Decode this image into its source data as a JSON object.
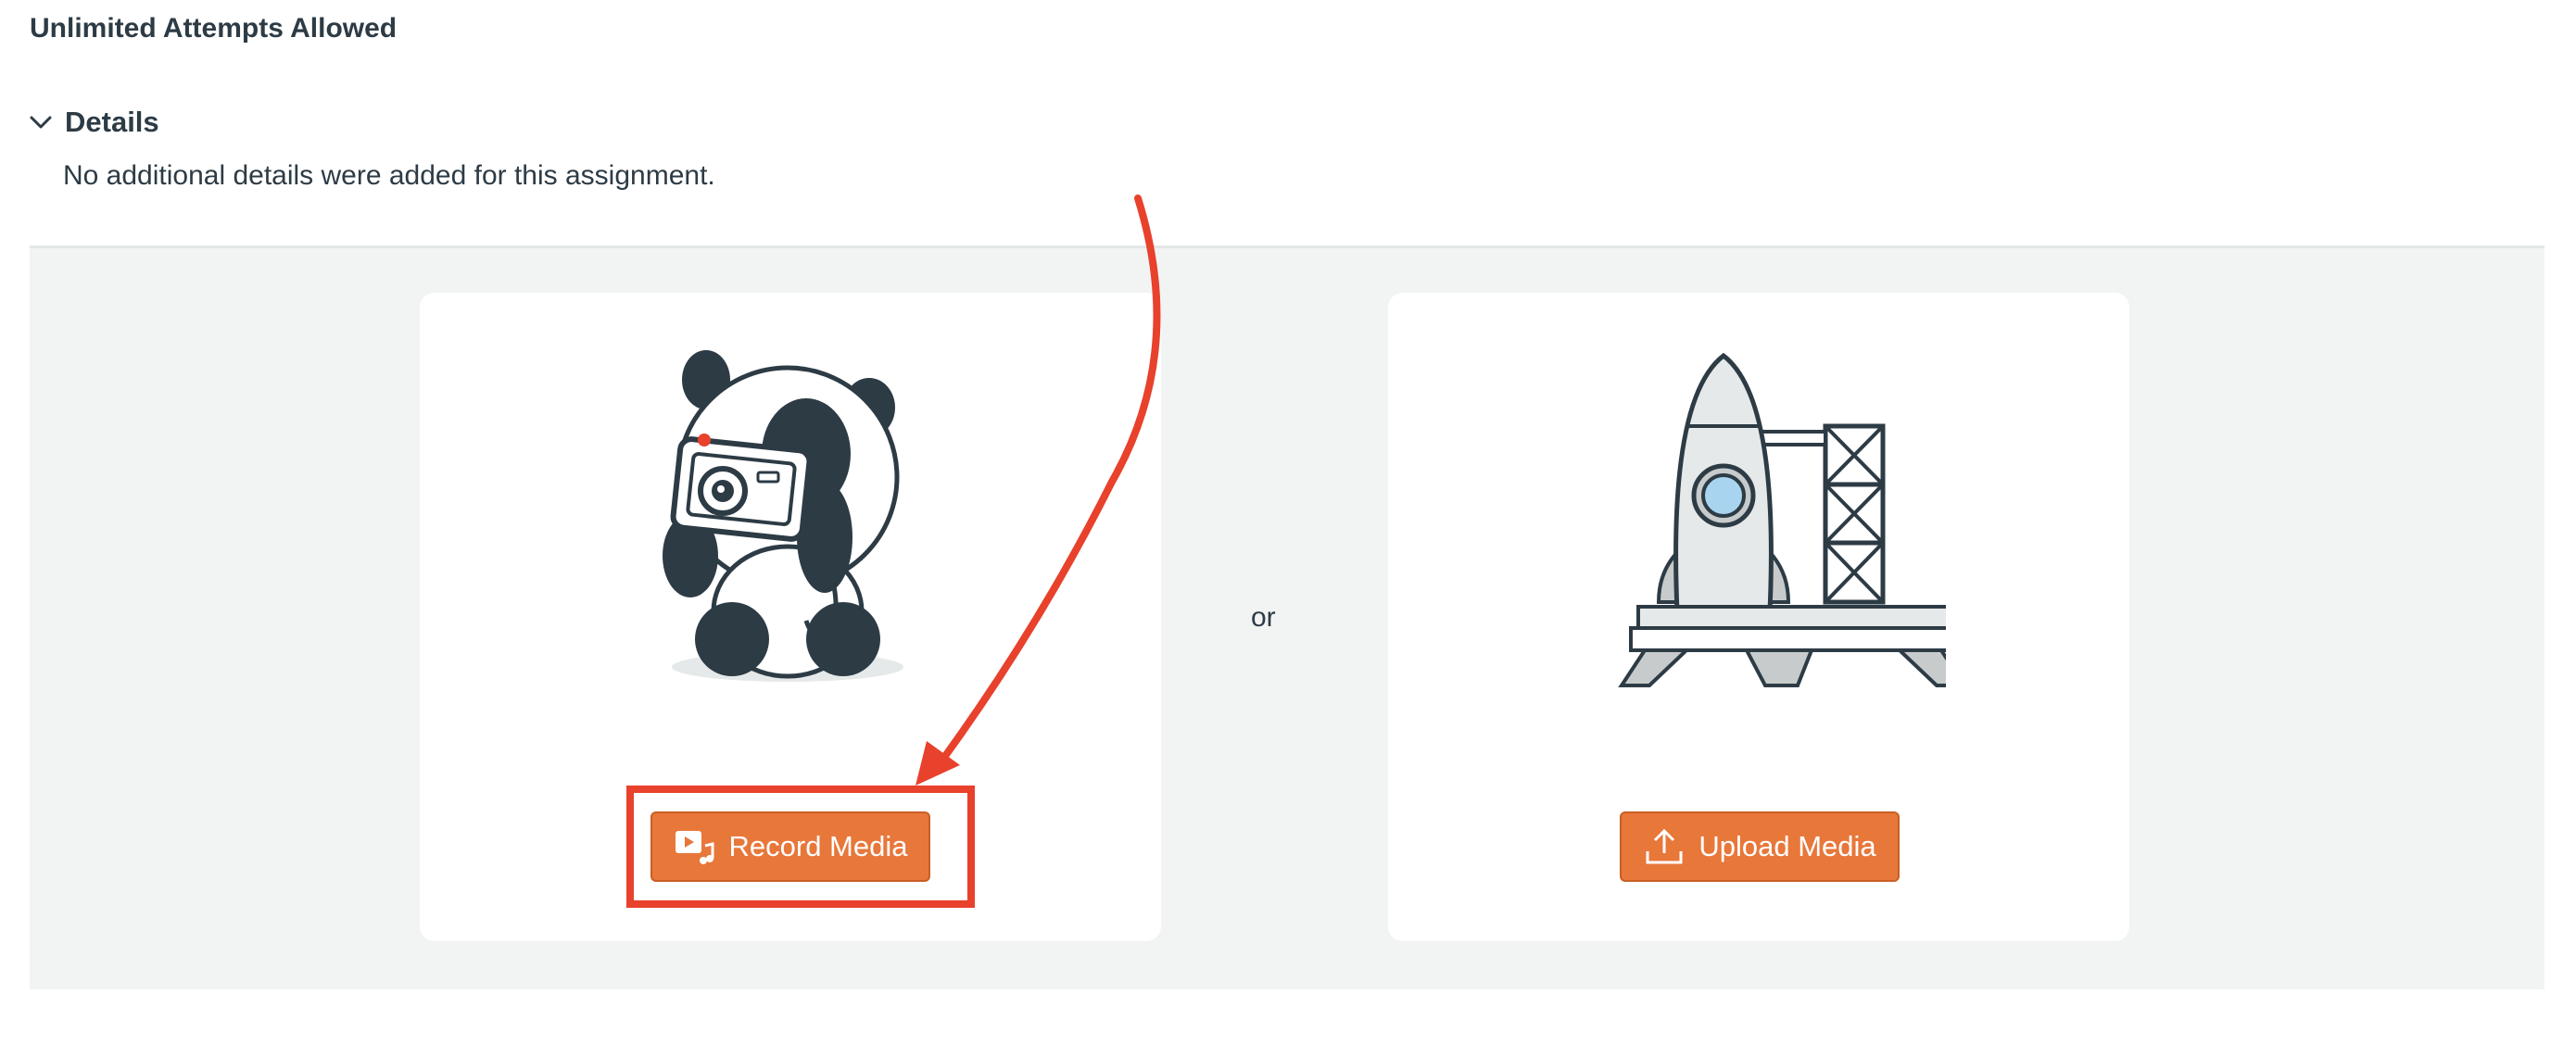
{
  "header": {
    "attempts_label": "Unlimited Attempts Allowed"
  },
  "details": {
    "toggle_label": "Details",
    "body_text": "No additional details were added for this assignment."
  },
  "submission": {
    "or_text": "or",
    "record_button_label": "Record Media",
    "upload_button_label": "Upload Media",
    "record_icon": "video-music-icon",
    "upload_icon": "upload-arrow-icon"
  },
  "annotation": {
    "color": "#e8412c"
  },
  "colors": {
    "button": "#e8773a",
    "panel": "#f2f4f4",
    "text": "#2d3b45"
  }
}
